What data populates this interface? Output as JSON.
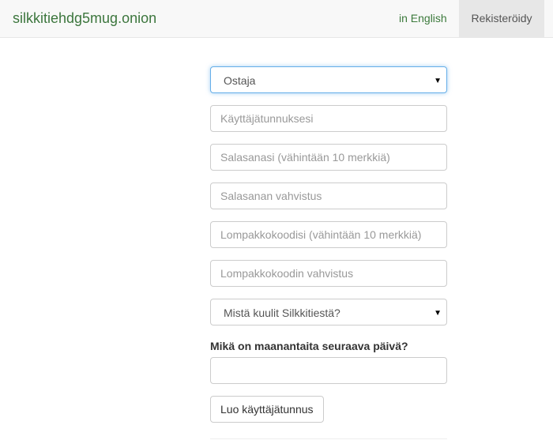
{
  "navbar": {
    "brand": "silkkitiehdg5mug.onion",
    "language_link": "in English",
    "register_link": "Rekisteröidy"
  },
  "form": {
    "account_type": {
      "selected": "Ostaja"
    },
    "username": {
      "placeholder": "Käyttäjätunnuksesi",
      "value": ""
    },
    "password": {
      "placeholder": "Salasanasi (vähintään 10 merkkiä)",
      "value": ""
    },
    "password_confirm": {
      "placeholder": "Salasanan vahvistus",
      "value": ""
    },
    "wallet_code": {
      "placeholder": "Lompakkokoodisi (vähintään 10 merkkiä)",
      "value": ""
    },
    "wallet_code_confirm": {
      "placeholder": "Lompakkokoodin vahvistus",
      "value": ""
    },
    "referral": {
      "selected": "Mistä kuulit Silkkitiestä?"
    },
    "captcha_question": "Mikä on maanantaita seuraava päivä?",
    "captcha_answer": {
      "value": ""
    },
    "submit_label": "Luo käyttäjätunnus"
  },
  "icons": {
    "dropdown_arrow": "▼"
  }
}
